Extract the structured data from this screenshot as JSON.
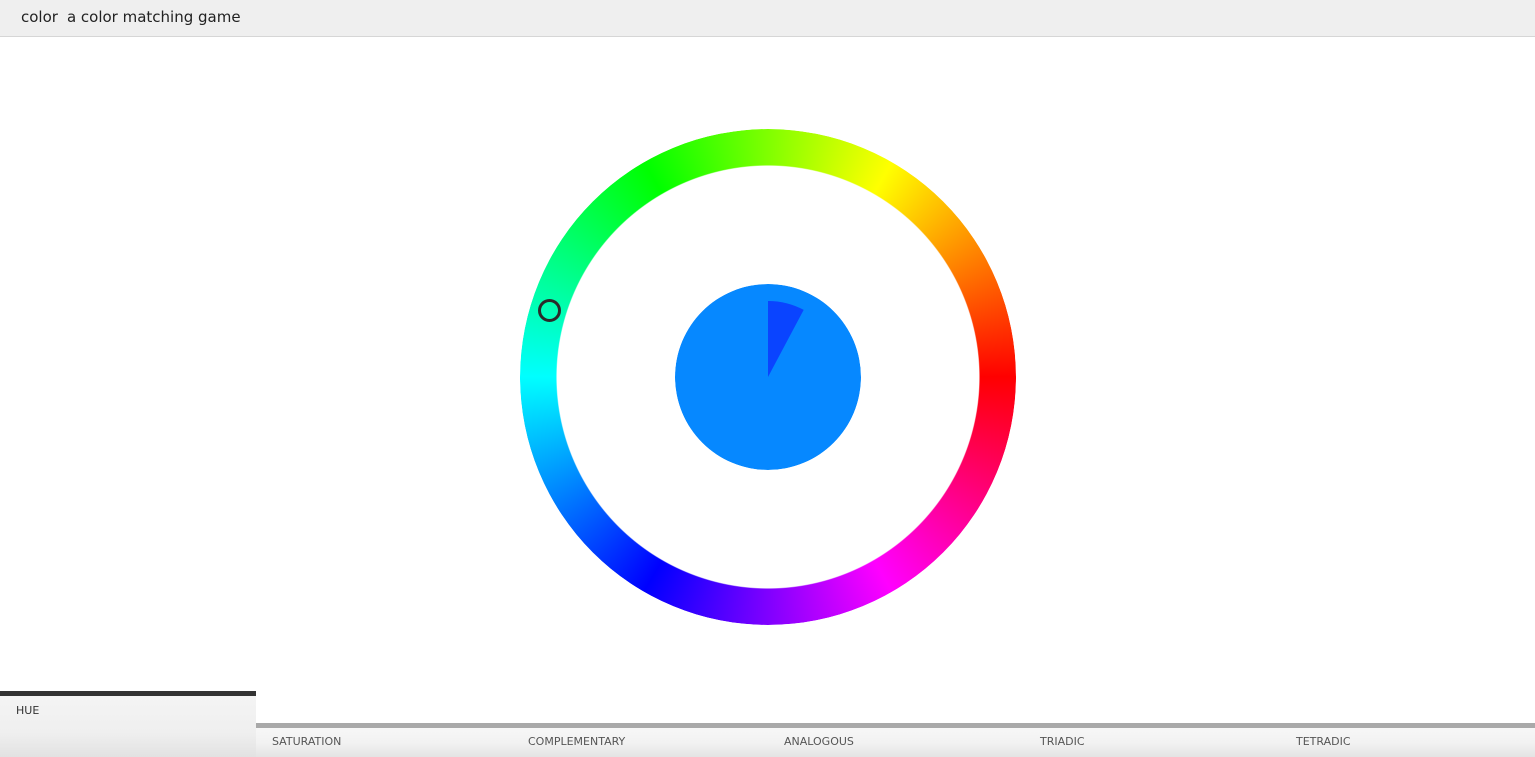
{
  "header": {
    "app_name": "color",
    "subtitle": "a color matching game"
  },
  "wheel": {
    "handle_hue_deg": 197,
    "center_color": "#0688ff",
    "target_wedge_color": "#0a44ff"
  },
  "tabs": [
    {
      "id": "hue",
      "label": "HUE",
      "active": true
    },
    {
      "id": "saturation",
      "label": "SATURATION",
      "active": false
    },
    {
      "id": "complementary",
      "label": "COMPLEMENTARY",
      "active": false
    },
    {
      "id": "analogous",
      "label": "ANALOGOUS",
      "active": false
    },
    {
      "id": "triadic",
      "label": "TRIADIC",
      "active": false
    },
    {
      "id": "tetradic",
      "label": "TETRADIC",
      "active": false
    }
  ]
}
